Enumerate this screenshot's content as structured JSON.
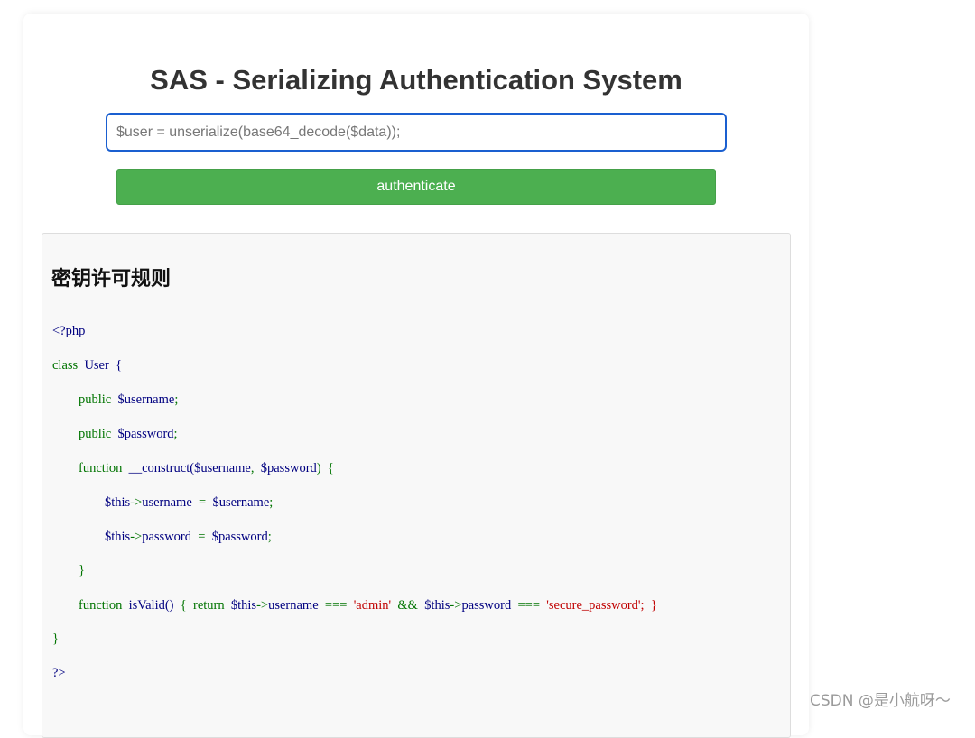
{
  "page": {
    "title": "SAS - Serializing Authentication System",
    "input_placeholder": "$user = unserialize(base64_decode($data));",
    "button_label": "authenticate"
  },
  "code_panel": {
    "heading": "密钥许可规则",
    "lines": [
      {
        "segments": [
          {
            "t": "<?php",
            "c": "plain"
          }
        ]
      },
      {
        "segments": [
          {
            "t": "class",
            "c": "kw"
          },
          {
            "t": "  User  {",
            "c": "plain"
          }
        ]
      },
      {
        "segments": [
          {
            "t": "        ",
            "c": "plain"
          },
          {
            "t": "public",
            "c": "kw"
          },
          {
            "t": "  $username",
            "c": "var"
          },
          {
            "t": ";",
            "c": "op"
          }
        ]
      },
      {
        "segments": [
          {
            "t": "        ",
            "c": "plain"
          },
          {
            "t": "public",
            "c": "kw"
          },
          {
            "t": "  $password",
            "c": "var"
          },
          {
            "t": ";",
            "c": "op"
          }
        ]
      },
      {
        "segments": [
          {
            "t": "        ",
            "c": "plain"
          },
          {
            "t": "function",
            "c": "kw"
          },
          {
            "t": "  __construct(",
            "c": "var"
          },
          {
            "t": "$username",
            "c": "var"
          },
          {
            "t": ",  ",
            "c": "op"
          },
          {
            "t": "$password",
            "c": "var"
          },
          {
            "t": ")  {",
            "c": "op"
          }
        ]
      },
      {
        "segments": [
          {
            "t": "                ",
            "c": "plain"
          },
          {
            "t": "$this",
            "c": "var"
          },
          {
            "t": "->",
            "c": "op"
          },
          {
            "t": "username",
            "c": "var"
          },
          {
            "t": "  =  ",
            "c": "op"
          },
          {
            "t": "$username",
            "c": "var"
          },
          {
            "t": ";",
            "c": "op"
          }
        ]
      },
      {
        "segments": [
          {
            "t": "                ",
            "c": "plain"
          },
          {
            "t": "$this",
            "c": "var"
          },
          {
            "t": "->",
            "c": "op"
          },
          {
            "t": "password",
            "c": "var"
          },
          {
            "t": "  =  ",
            "c": "op"
          },
          {
            "t": "$password",
            "c": "var"
          },
          {
            "t": ";",
            "c": "op"
          }
        ]
      },
      {
        "segments": [
          {
            "t": "        ",
            "c": "plain"
          },
          {
            "t": "}",
            "c": "op"
          }
        ]
      },
      {
        "segments": [
          {
            "t": "        ",
            "c": "plain"
          },
          {
            "t": "function",
            "c": "kw"
          },
          {
            "t": "  isValid()",
            "c": "var"
          },
          {
            "t": "  {  ",
            "c": "op"
          },
          {
            "t": "return",
            "c": "kw"
          },
          {
            "t": "  $this",
            "c": "var"
          },
          {
            "t": "->",
            "c": "op"
          },
          {
            "t": "username",
            "c": "var"
          },
          {
            "t": "  ===  ",
            "c": "op"
          },
          {
            "t": "'admin'",
            "c": "str"
          },
          {
            "t": "  &&  ",
            "c": "op"
          },
          {
            "t": "$this",
            "c": "var"
          },
          {
            "t": "->",
            "c": "op"
          },
          {
            "t": "password",
            "c": "var"
          },
          {
            "t": "  ===  ",
            "c": "op"
          },
          {
            "t": "'secure_password';  }",
            "c": "str"
          }
        ]
      },
      {
        "segments": [
          {
            "t": "}",
            "c": "op"
          }
        ]
      },
      {
        "segments": [
          {
            "t": "?>",
            "c": "plain"
          }
        ]
      }
    ]
  },
  "watermark": "CSDN @是小航呀～",
  "colors": {
    "button": "#4caf50",
    "input_border": "#1a5fd0",
    "keyword": "#007400",
    "variable": "#000080",
    "string": "#c00000"
  }
}
